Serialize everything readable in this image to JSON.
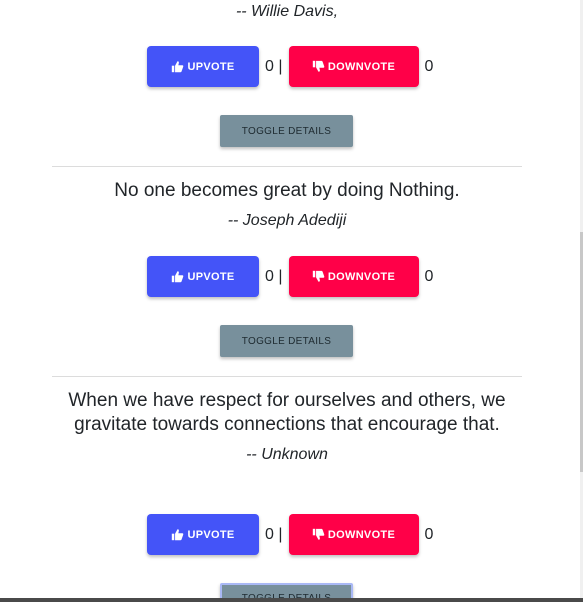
{
  "quotes": [
    {
      "text": "",
      "author": "-- Willie Davis,",
      "upvote_label": "UPVOTE",
      "downvote_label": "DOWNVOTE",
      "upvote_count": "0 |",
      "downvote_count": "0",
      "toggle_label": "TOGGLE DETAILS"
    },
    {
      "text": "No one becomes great by doing Nothing.",
      "author": "-- Joseph Adediji",
      "upvote_label": "UPVOTE",
      "downvote_label": "DOWNVOTE",
      "upvote_count": "0 |",
      "downvote_count": "0",
      "toggle_label": "TOGGLE DETAILS"
    },
    {
      "text": "When we have respect for ourselves and others, we gravitate towards connections that encourage that.",
      "author": "-- Unknown",
      "upvote_label": "UPVOTE",
      "downvote_label": "DOWNVOTE",
      "upvote_count": "0 |",
      "downvote_count": "0",
      "toggle_label": "TOGGLE DETAILS"
    }
  ],
  "icons": {
    "upvote": "thumbs-up-icon",
    "downvote": "thumbs-down-icon"
  },
  "colors": {
    "upvote_button": "#4454f8",
    "downvote_button": "#ff0048",
    "toggle_button": "#78909c"
  }
}
